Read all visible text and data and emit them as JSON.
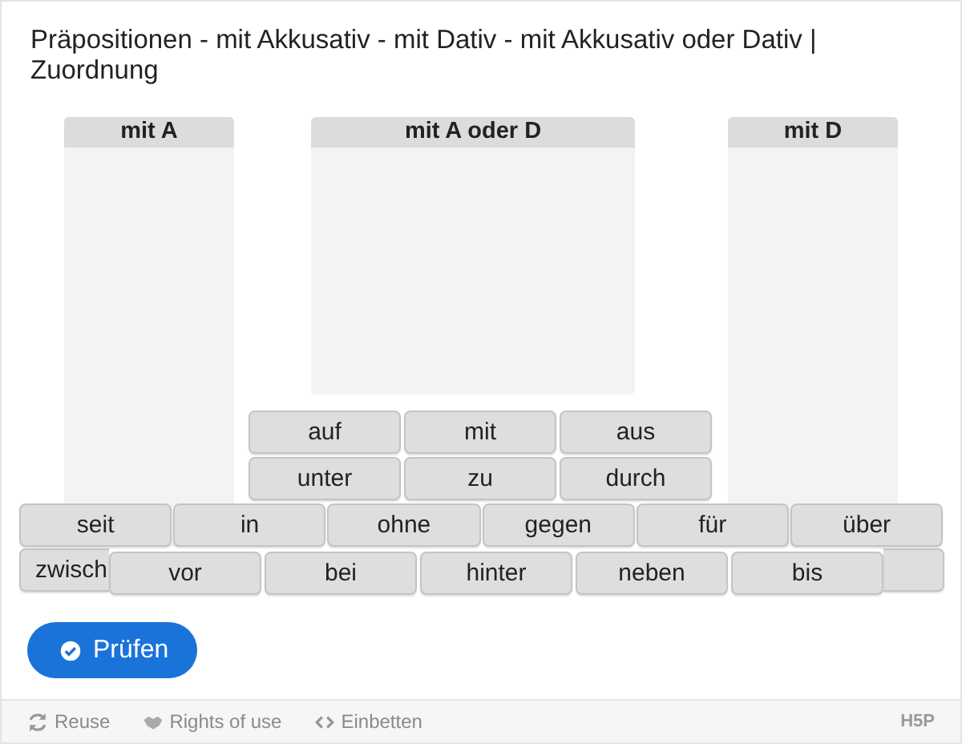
{
  "title": "Präpositionen - mit Akkusativ - mit Dativ - mit Akkusativ oder Dativ | Zuordnung",
  "zones": [
    {
      "label": "mit A"
    },
    {
      "label": "mit A oder D"
    },
    {
      "label": "mit D"
    }
  ],
  "pool_rows": [
    [
      "auf",
      "mit",
      "aus"
    ],
    [
      "unter",
      "zu",
      "durch"
    ],
    [
      "seit",
      "in",
      "ohne",
      "gegen",
      "für",
      "über"
    ]
  ],
  "covered_row": [
    {
      "kind": "word",
      "text": "zwisch"
    },
    {
      "kind": "blank"
    }
  ],
  "top_row": [
    "vor",
    "bei",
    "hinter",
    "neben",
    "bis"
  ],
  "check_button": "Prüfen",
  "footer": {
    "links": [
      {
        "kind": "reuse",
        "label": "Reuse"
      },
      {
        "kind": "rights",
        "label": "Rights of use"
      },
      {
        "kind": "embed",
        "label": "Einbetten"
      }
    ],
    "logo": "H5P"
  }
}
